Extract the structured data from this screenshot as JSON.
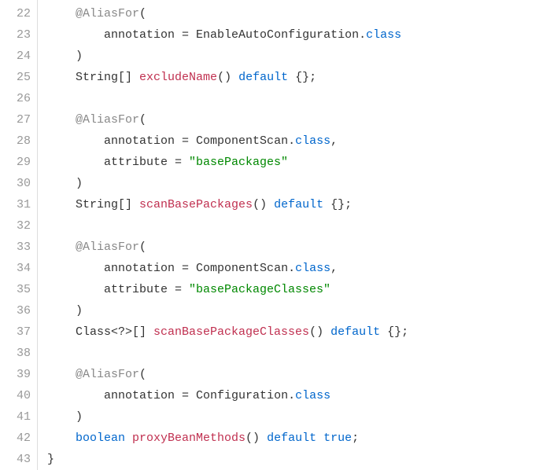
{
  "gutter": {
    "start": 22,
    "end": 43
  },
  "lines": [
    {
      "indent": 1,
      "tokens": [
        {
          "t": "@AliasFor",
          "c": "annotation"
        },
        {
          "t": "(",
          "c": "paren"
        }
      ]
    },
    {
      "indent": 2,
      "tokens": [
        {
          "t": "annotation ",
          "c": "default"
        },
        {
          "t": "= ",
          "c": "default"
        },
        {
          "t": "EnableAutoConfiguration",
          "c": "class"
        },
        {
          "t": ".",
          "c": "default"
        },
        {
          "t": "class",
          "c": "keyword"
        }
      ]
    },
    {
      "indent": 1,
      "tokens": [
        {
          "t": ")",
          "c": "paren"
        }
      ]
    },
    {
      "indent": 1,
      "tokens": [
        {
          "t": "String",
          "c": "class"
        },
        {
          "t": "[] ",
          "c": "default"
        },
        {
          "t": "excludeName",
          "c": "method"
        },
        {
          "t": "() ",
          "c": "paren"
        },
        {
          "t": "default ",
          "c": "keyword"
        },
        {
          "t": "{};",
          "c": "default"
        }
      ]
    },
    {
      "indent": 0,
      "tokens": []
    },
    {
      "indent": 1,
      "tokens": [
        {
          "t": "@AliasFor",
          "c": "annotation"
        },
        {
          "t": "(",
          "c": "paren"
        }
      ]
    },
    {
      "indent": 2,
      "tokens": [
        {
          "t": "annotation ",
          "c": "default"
        },
        {
          "t": "= ",
          "c": "default"
        },
        {
          "t": "ComponentScan",
          "c": "class"
        },
        {
          "t": ".",
          "c": "default"
        },
        {
          "t": "class",
          "c": "keyword"
        },
        {
          "t": ",",
          "c": "default"
        }
      ]
    },
    {
      "indent": 2,
      "tokens": [
        {
          "t": "attribute ",
          "c": "default"
        },
        {
          "t": "= ",
          "c": "default"
        },
        {
          "t": "\"basePackages\"",
          "c": "string"
        }
      ]
    },
    {
      "indent": 1,
      "tokens": [
        {
          "t": ")",
          "c": "paren"
        }
      ]
    },
    {
      "indent": 1,
      "tokens": [
        {
          "t": "String",
          "c": "class"
        },
        {
          "t": "[] ",
          "c": "default"
        },
        {
          "t": "scanBasePackages",
          "c": "method"
        },
        {
          "t": "() ",
          "c": "paren"
        },
        {
          "t": "default ",
          "c": "keyword"
        },
        {
          "t": "{};",
          "c": "default"
        }
      ]
    },
    {
      "indent": 0,
      "tokens": []
    },
    {
      "indent": 1,
      "tokens": [
        {
          "t": "@AliasFor",
          "c": "annotation"
        },
        {
          "t": "(",
          "c": "paren"
        }
      ]
    },
    {
      "indent": 2,
      "tokens": [
        {
          "t": "annotation ",
          "c": "default"
        },
        {
          "t": "= ",
          "c": "default"
        },
        {
          "t": "ComponentScan",
          "c": "class"
        },
        {
          "t": ".",
          "c": "default"
        },
        {
          "t": "class",
          "c": "keyword"
        },
        {
          "t": ",",
          "c": "default"
        }
      ]
    },
    {
      "indent": 2,
      "tokens": [
        {
          "t": "attribute ",
          "c": "default"
        },
        {
          "t": "= ",
          "c": "default"
        },
        {
          "t": "\"basePackageClasses\"",
          "c": "string"
        }
      ]
    },
    {
      "indent": 1,
      "tokens": [
        {
          "t": ")",
          "c": "paren"
        }
      ]
    },
    {
      "indent": 1,
      "tokens": [
        {
          "t": "Class",
          "c": "class"
        },
        {
          "t": "<?>[] ",
          "c": "default"
        },
        {
          "t": "scanBasePackageClasses",
          "c": "method"
        },
        {
          "t": "() ",
          "c": "paren"
        },
        {
          "t": "default ",
          "c": "keyword"
        },
        {
          "t": "{};",
          "c": "default"
        }
      ]
    },
    {
      "indent": 0,
      "tokens": []
    },
    {
      "indent": 1,
      "tokens": [
        {
          "t": "@AliasFor",
          "c": "annotation"
        },
        {
          "t": "(",
          "c": "paren"
        }
      ]
    },
    {
      "indent": 2,
      "tokens": [
        {
          "t": "annotation ",
          "c": "default"
        },
        {
          "t": "= ",
          "c": "default"
        },
        {
          "t": "Configuration",
          "c": "class"
        },
        {
          "t": ".",
          "c": "default"
        },
        {
          "t": "class",
          "c": "keyword"
        }
      ]
    },
    {
      "indent": 1,
      "tokens": [
        {
          "t": ")",
          "c": "paren"
        }
      ]
    },
    {
      "indent": 1,
      "tokens": [
        {
          "t": "boolean ",
          "c": "keyword"
        },
        {
          "t": "proxyBeanMethods",
          "c": "method"
        },
        {
          "t": "() ",
          "c": "paren"
        },
        {
          "t": "default ",
          "c": "keyword"
        },
        {
          "t": "true",
          "c": "keyword"
        },
        {
          "t": ";",
          "c": "default"
        }
      ]
    },
    {
      "indent": 0,
      "tokens": [
        {
          "t": "}",
          "c": "default"
        }
      ]
    }
  ]
}
